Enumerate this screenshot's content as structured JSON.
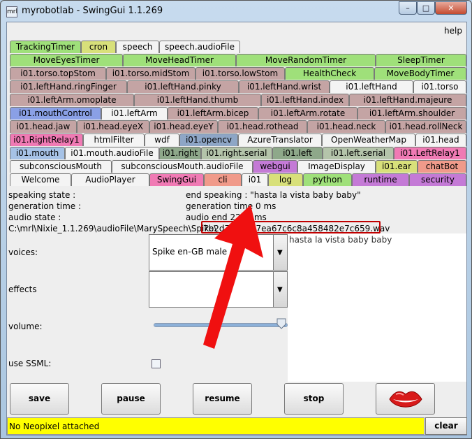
{
  "window": {
    "icon": "mrl",
    "title": "myrobotlab - SwingGui 1.1.269",
    "min": "–",
    "max": "□",
    "close": "✕"
  },
  "menu": {
    "help": "help"
  },
  "tabs": [
    [
      {
        "l": "TrackingTimer",
        "c": "#9fe07a"
      },
      {
        "l": "cron",
        "c": "#d8e07a"
      },
      {
        "l": "speech",
        "c": "#f4f4f4"
      },
      {
        "l": "speech.audioFile",
        "c": "#f4f4f4"
      }
    ],
    [
      {
        "l": "MoveEyesTimer",
        "c": "#9fe07a"
      },
      {
        "l": "MoveHeadTimer",
        "c": "#9fe07a"
      },
      {
        "l": "MoveRandomTimer",
        "c": "#9fe07a"
      },
      {
        "l": "SleepTimer",
        "c": "#9fe07a"
      }
    ],
    [
      {
        "l": "i01.torso.topStom",
        "c": "#c4a4a4"
      },
      {
        "l": "i01.torso.midStom",
        "c": "#c4a4a4"
      },
      {
        "l": "i01.torso.lowStom",
        "c": "#c4a4a4"
      },
      {
        "l": "HealthCheck",
        "c": "#9fe07a"
      },
      {
        "l": "MoveBodyTimer",
        "c": "#9fe07a"
      }
    ],
    [
      {
        "l": "i01.leftHand.ringFinger",
        "c": "#c4a4a4"
      },
      {
        "l": "i01.leftHand.pinky",
        "c": "#c4a4a4"
      },
      {
        "l": "i01.leftHand.wrist",
        "c": "#c4a4a4"
      },
      {
        "l": "i01.leftHand",
        "c": "#f4f4f4"
      },
      {
        "l": "i01.torso",
        "c": "#f4f4f4"
      }
    ],
    [
      {
        "l": "i01.leftArm.omoplate",
        "c": "#c4a4a4"
      },
      {
        "l": "i01.leftHand.thumb",
        "c": "#c4a4a4"
      },
      {
        "l": "i01.leftHand.index",
        "c": "#c4a4a4"
      },
      {
        "l": "i01.leftHand.majeure",
        "c": "#c4a4a4"
      }
    ],
    [
      {
        "l": "i01.mouthControl",
        "c": "#8aa0e6"
      },
      {
        "l": "i01.leftArm",
        "c": "#f4f4f4"
      },
      {
        "l": "i01.leftArm.bicep",
        "c": "#c4a4a4"
      },
      {
        "l": "i01.leftArm.rotate",
        "c": "#c4a4a4"
      },
      {
        "l": "i01.leftArm.shoulder",
        "c": "#c4a4a4"
      }
    ],
    [
      {
        "l": "i01.head.jaw",
        "c": "#c4a4a4"
      },
      {
        "l": "i01.head.eyeX",
        "c": "#c4a4a4"
      },
      {
        "l": "i01.head.eyeY",
        "c": "#c4a4a4"
      },
      {
        "l": "i01.head.rothead",
        "c": "#c4a4a4"
      },
      {
        "l": "i01.head.neck",
        "c": "#c4a4a4"
      },
      {
        "l": "i01.head.rollNeck",
        "c": "#c4a4a4"
      }
    ],
    [
      {
        "l": "i01.RightRelay1",
        "c": "#f07ab4"
      },
      {
        "l": "htmlFilter",
        "c": "#f4f4f4"
      },
      {
        "l": "wdf",
        "c": "#f4f4f4"
      },
      {
        "l": "i01.opencv",
        "c": "#8ea6c6"
      },
      {
        "l": "AzureTranslator",
        "c": "#f4f4f4"
      },
      {
        "l": "OpenWeatherMap",
        "c": "#f4f4f4"
      },
      {
        "l": "i01.head",
        "c": "#f4f4f4"
      }
    ],
    [
      {
        "l": "i01.mouth",
        "c": "#a6c2e6"
      },
      {
        "l": "i01.mouth.audioFile",
        "c": "#f4f4f4"
      },
      {
        "l": "i01.right",
        "c": "#8ea88a"
      },
      {
        "l": "i01.right.serial",
        "c": "#b4c4aa"
      },
      {
        "l": "i01.left",
        "c": "#8ea88a"
      },
      {
        "l": "i01.left.serial",
        "c": "#b4c4aa"
      },
      {
        "l": "i01.LeftRelay1",
        "c": "#f07ab4"
      }
    ],
    [
      {
        "l": "subconsciousMouth",
        "c": "#f4f4f4"
      },
      {
        "l": "subconsciousMouth.audioFile",
        "c": "#f4f4f4"
      },
      {
        "l": "webgui",
        "c": "#c47ad6"
      },
      {
        "l": "ImageDisplay",
        "c": "#f4f4f4"
      },
      {
        "l": "i01.ear",
        "c": "#d8e07a"
      },
      {
        "l": "chatBot",
        "c": "#f09a8a"
      }
    ],
    [
      {
        "l": "Welcome",
        "c": "#f4f4f4"
      },
      {
        "l": "AudioPlayer",
        "c": "#f4f4f4"
      },
      {
        "l": "SwingGui",
        "c": "#f07ab4"
      },
      {
        "l": "cli",
        "c": "#f09a8a"
      },
      {
        "l": "i01",
        "c": "#f4f4f4"
      },
      {
        "l": "log",
        "c": "#d8e07a"
      },
      {
        "l": "python",
        "c": "#9fe07a"
      },
      {
        "l": "runtime",
        "c": "#c47ad6"
      },
      {
        "l": "security",
        "c": "#c47ad6"
      }
    ]
  ],
  "info": {
    "speaking_state": "speaking state :",
    "generation_time": "generation time :",
    "audio_state": "audio state :",
    "end_speaking": "end speaking    : \"hasta la vista baby baby\"",
    "generation_value": "generation time 0 ms",
    "audio_end": "audio end 2288 ms",
    "path_prefix": "C:\\mrl\\Nixie_1.1.269\\audioFile\\MarySpeech\\Spike\\",
    "path_file": "7b2d7dae5a7ea67c6c8a458482e7c659.wav"
  },
  "textarea": {
    "text": "hasta la vista baby baby"
  },
  "voices": {
    "label": "voices:",
    "value": "Spike en-GB male"
  },
  "effects": {
    "label": "effects",
    "value": ""
  },
  "volume": {
    "label": "volume:",
    "level": 1.0
  },
  "ssml": {
    "label": "use SSML:",
    "checked": false
  },
  "buttons": {
    "save": "save",
    "pause": "pause",
    "resume": "resume",
    "stop": "stop"
  },
  "status": {
    "text": "No Neopixel attached",
    "clear": "clear"
  }
}
